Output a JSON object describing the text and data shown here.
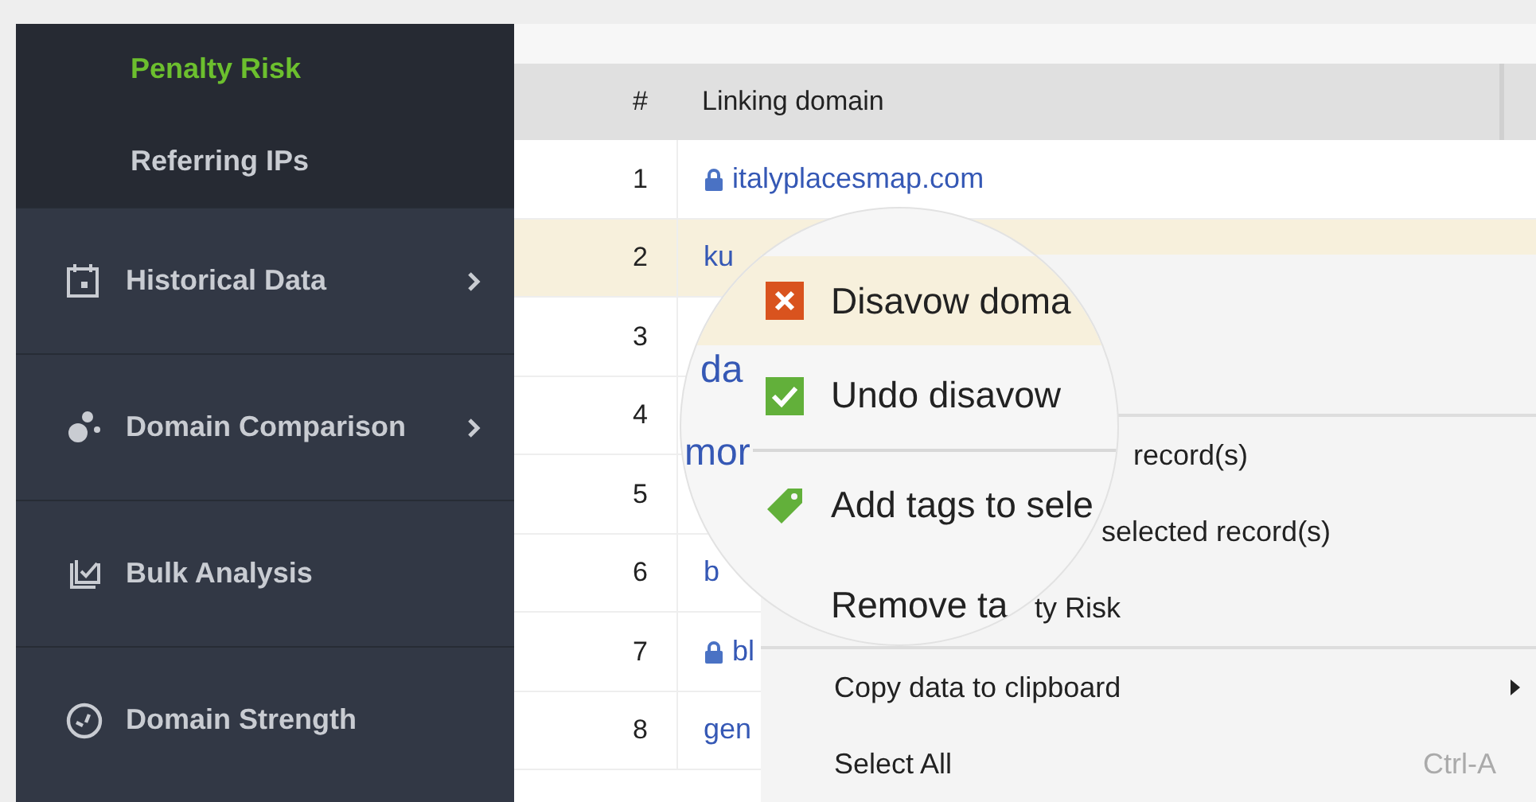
{
  "sidebar": {
    "subitems": [
      {
        "label": "Penalty Risk",
        "selected": true
      },
      {
        "label": "Referring IPs",
        "selected": false
      }
    ],
    "items": [
      {
        "label": "Historical Data",
        "kind": "calendar",
        "submenu": true
      },
      {
        "label": "Domain Comparison",
        "kind": "dots",
        "submenu": true
      },
      {
        "label": "Bulk Analysis",
        "kind": "check",
        "submenu": false
      },
      {
        "label": "Domain Strength",
        "kind": "gauge",
        "submenu": false
      }
    ]
  },
  "table": {
    "columns": [
      "#",
      "Linking domain"
    ],
    "rows": [
      {
        "number": "1",
        "domain": "italyplacesmap.com",
        "secure": true,
        "selected": false
      },
      {
        "number": "2",
        "domain": "ku",
        "secure": false,
        "selected": true
      },
      {
        "number": "3",
        "domain": "",
        "secure": false,
        "selected": false
      },
      {
        "number": "4",
        "domain": "",
        "secure": false,
        "selected": false
      },
      {
        "number": "5",
        "domain": "",
        "secure": false,
        "selected": false
      },
      {
        "number": "6",
        "domain": "b",
        "secure": false,
        "selected": false
      },
      {
        "number": "7",
        "domain": "bl",
        "secure": true,
        "selected": false
      },
      {
        "number": "8",
        "domain": "gen",
        "secure": false,
        "selected": false
      }
    ]
  },
  "context_menu": {
    "items": [
      {
        "kind": "separator"
      },
      {
        "kind": "item",
        "label": "record(s)"
      },
      {
        "kind": "item",
        "label": "selected record(s)"
      },
      {
        "kind": "item",
        "label": "ty Risk"
      },
      {
        "kind": "separator"
      },
      {
        "kind": "item",
        "label": "Copy data to clipboard",
        "submenu": true
      },
      {
        "kind": "item",
        "label": "Select All",
        "shortcut": "Ctrl-A"
      }
    ]
  },
  "magnifier": {
    "fragments": [
      "da",
      "mor"
    ],
    "items": [
      {
        "kind": "disavow",
        "label": "Disavow doma",
        "highlighted": true
      },
      {
        "kind": "undo",
        "label": "Undo disavow",
        "highlighted": false
      },
      {
        "kind": "separator"
      },
      {
        "kind": "tag",
        "label": "Add tags to sele",
        "highlighted": false
      },
      {
        "kind": "plain",
        "label": "Remove ta",
        "highlighted": false
      }
    ]
  }
}
